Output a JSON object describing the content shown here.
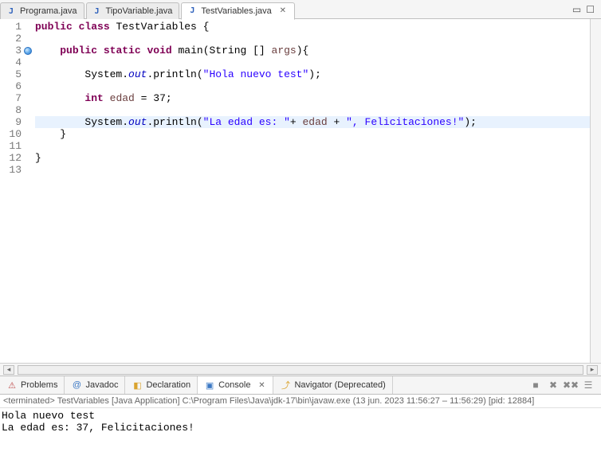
{
  "tabs": [
    {
      "label": "Programa.java",
      "active": false
    },
    {
      "label": "TipoVariable.java",
      "active": false
    },
    {
      "label": "TestVariables.java",
      "active": true
    }
  ],
  "code": {
    "lines": [
      {
        "n": "1",
        "tokens": [
          [
            "kw",
            "public"
          ],
          [
            "txt",
            " "
          ],
          [
            "kw",
            "class"
          ],
          [
            "txt",
            " TestVariables {"
          ]
        ]
      },
      {
        "n": "2",
        "tokens": []
      },
      {
        "n": "3",
        "marker": true,
        "tokens": [
          [
            "txt",
            "    "
          ],
          [
            "kw",
            "public"
          ],
          [
            "txt",
            " "
          ],
          [
            "kw",
            "static"
          ],
          [
            "txt",
            " "
          ],
          [
            "kw",
            "void"
          ],
          [
            "txt",
            " main(String [] "
          ],
          [
            "param",
            "args"
          ],
          [
            "txt",
            "){"
          ]
        ]
      },
      {
        "n": "4",
        "tokens": []
      },
      {
        "n": "5",
        "tokens": [
          [
            "txt",
            "        System."
          ],
          [
            "fld",
            "out"
          ],
          [
            "txt",
            ".println("
          ],
          [
            "str",
            "\"Hola nuevo test\""
          ],
          [
            "txt",
            ");"
          ]
        ]
      },
      {
        "n": "6",
        "tokens": []
      },
      {
        "n": "7",
        "tokens": [
          [
            "txt",
            "        "
          ],
          [
            "kw",
            "int"
          ],
          [
            "txt",
            " "
          ],
          [
            "param",
            "edad"
          ],
          [
            "txt",
            " = 37;"
          ]
        ]
      },
      {
        "n": "8",
        "tokens": []
      },
      {
        "n": "9",
        "highlight": true,
        "tokens": [
          [
            "txt",
            "        System."
          ],
          [
            "fld",
            "out"
          ],
          [
            "txt",
            ".println("
          ],
          [
            "str",
            "\"La edad es: \""
          ],
          [
            "txt",
            "+ "
          ],
          [
            "param",
            "edad"
          ],
          [
            "txt",
            " + "
          ],
          [
            "str",
            "\", Felicitaciones!\""
          ],
          [
            "txt",
            ");"
          ]
        ]
      },
      {
        "n": "10",
        "tokens": [
          [
            "txt",
            "    }"
          ]
        ]
      },
      {
        "n": "11",
        "tokens": []
      },
      {
        "n": "12",
        "tokens": [
          [
            "txt",
            "}"
          ]
        ]
      },
      {
        "n": "13",
        "tokens": []
      }
    ]
  },
  "views": [
    {
      "label": "Problems",
      "icon": "⚠",
      "iconColor": "#c05050",
      "active": false
    },
    {
      "label": "Javadoc",
      "icon": "@",
      "iconColor": "#3b78c4",
      "active": false
    },
    {
      "label": "Declaration",
      "icon": "◧",
      "iconColor": "#d9a32e",
      "active": false
    },
    {
      "label": "Console",
      "icon": "▣",
      "iconColor": "#3b78c4",
      "active": true
    },
    {
      "label": "Navigator (Deprecated)",
      "icon": "⤴",
      "iconColor": "#d9a32e",
      "active": false
    }
  ],
  "console": {
    "status_prefix": "<terminated> ",
    "status_main": "TestVariables [Java Application] C:\\Program Files\\Java\\jdk-17\\bin\\javaw.exe (13 jun. 2023 11:56:27 – 11:56:29) [pid: 12884]",
    "output": "Hola nuevo test\nLa edad es: 37, Felicitaciones!"
  }
}
